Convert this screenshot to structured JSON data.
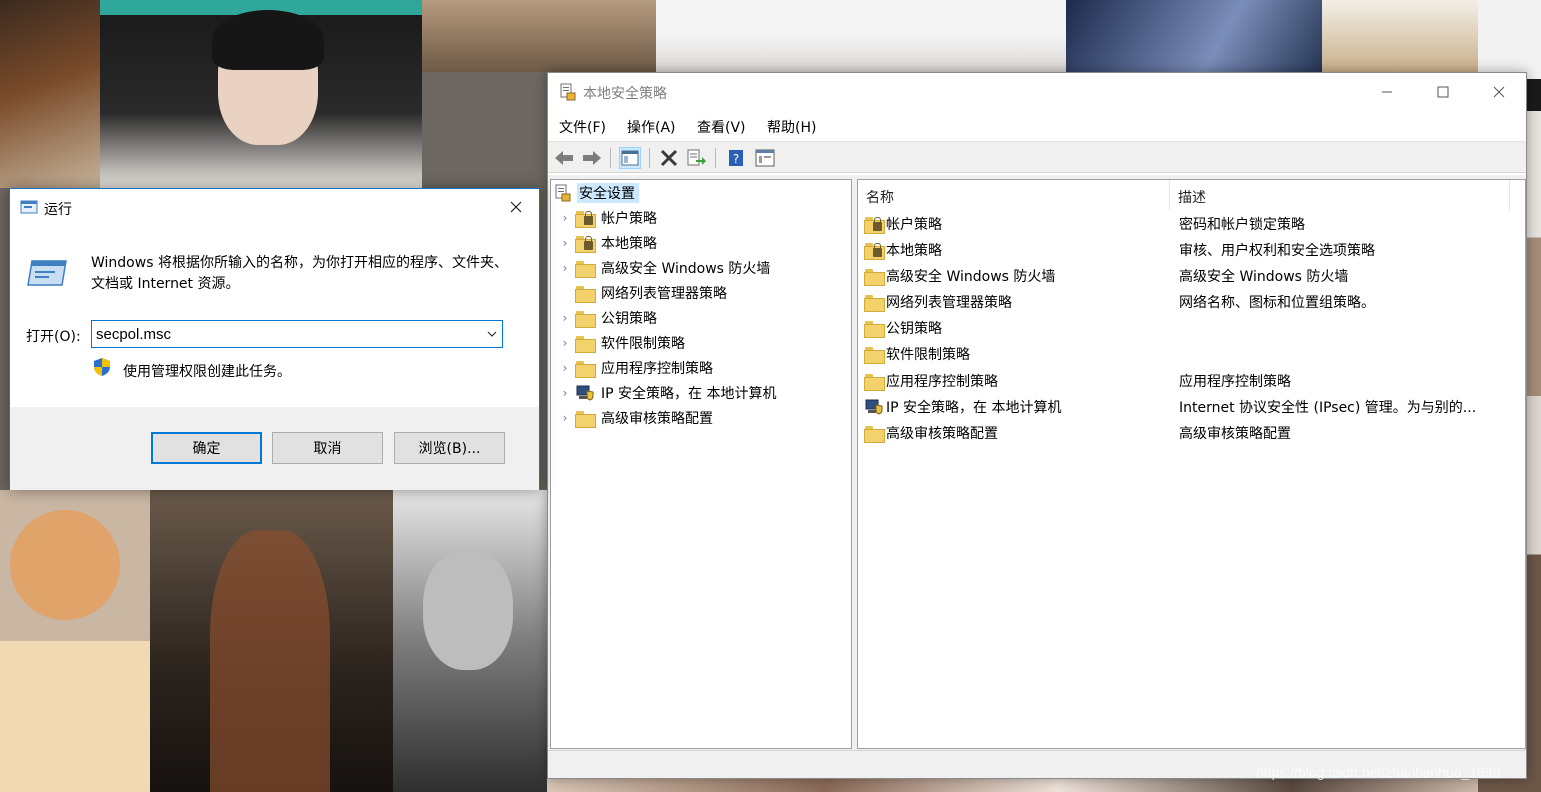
{
  "secpol": {
    "title": "本地安全策略",
    "menu": [
      "文件(F)",
      "操作(A)",
      "查看(V)",
      "帮助(H)"
    ],
    "tree": {
      "root": "安全设置",
      "items": [
        {
          "label": "帐户策略",
          "icon": "folder-lock-icon",
          "expandable": true
        },
        {
          "label": "本地策略",
          "icon": "folder-lock-icon",
          "expandable": true
        },
        {
          "label": "高级安全 Windows 防火墙",
          "icon": "folder-icon",
          "expandable": true
        },
        {
          "label": "网络列表管理器策略",
          "icon": "folder-icon",
          "expandable": false
        },
        {
          "label": "公钥策略",
          "icon": "folder-icon",
          "expandable": true
        },
        {
          "label": "软件限制策略",
          "icon": "folder-icon",
          "expandable": true
        },
        {
          "label": "应用程序控制策略",
          "icon": "folder-icon",
          "expandable": true
        },
        {
          "label": "IP 安全策略，在 本地计算机",
          "icon": "computer-shield-icon",
          "expandable": true
        },
        {
          "label": "高级审核策略配置",
          "icon": "folder-icon",
          "expandable": true
        }
      ]
    },
    "columns": [
      "名称",
      "描述"
    ],
    "rows": [
      {
        "name": "帐户策略",
        "desc": "密码和帐户锁定策略",
        "icon": "folder-lock-icon"
      },
      {
        "name": "本地策略",
        "desc": "审核、用户权利和安全选项策略",
        "icon": "folder-lock-icon"
      },
      {
        "name": "高级安全 Windows 防火墙",
        "desc": "高级安全 Windows 防火墙",
        "icon": "folder-icon"
      },
      {
        "name": "网络列表管理器策略",
        "desc": "网络名称、图标和位置组策略。",
        "icon": "folder-icon"
      },
      {
        "name": "公钥策略",
        "desc": "",
        "icon": "folder-icon"
      },
      {
        "name": "软件限制策略",
        "desc": "",
        "icon": "folder-icon"
      },
      {
        "name": "应用程序控制策略",
        "desc": "应用程序控制策略",
        "icon": "folder-icon"
      },
      {
        "name": "IP 安全策略，在 本地计算机",
        "desc": "Internet 协议安全性 (IPsec) 管理。为与别的...",
        "icon": "computer-shield-icon"
      },
      {
        "name": "高级审核策略配置",
        "desc": "高级审核策略配置",
        "icon": "folder-icon"
      }
    ]
  },
  "run": {
    "title": "运行",
    "description": "Windows 将根据你所输入的名称，为你打开相应的程序、文件夹、文档或 Internet 资源。",
    "open_label": "打开(O):",
    "input_value": "secpol.msc",
    "admin_note": "使用管理权限创建此任务。",
    "ok": "确定",
    "cancel": "取消",
    "browse": "浏览(B)..."
  },
  "watermark": "https://blog.csdn.net/zhaotianhuo_1998"
}
